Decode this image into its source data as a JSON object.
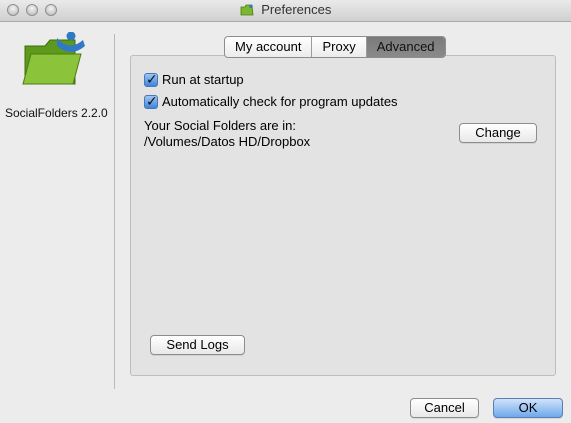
{
  "window": {
    "title": "Preferences"
  },
  "sidebar": {
    "app_name_version": "SocialFolders 2.2.0"
  },
  "tabs": [
    {
      "label": "My account",
      "active": false
    },
    {
      "label": "Proxy",
      "active": false
    },
    {
      "label": "Advanced",
      "active": true
    }
  ],
  "advanced": {
    "run_at_startup": {
      "label": "Run at startup",
      "checked": true
    },
    "auto_update": {
      "label": "Automatically check for program updates",
      "checked": true
    },
    "folders_location_label": "Your Social Folders are in:",
    "folders_location_path": "/Volumes/Datos HD/Dropbox",
    "change_button": "Change",
    "send_logs_button": "Send Logs"
  },
  "footer": {
    "cancel_button": "Cancel",
    "ok_button": "OK"
  },
  "colors": {
    "window_bg": "#ececec",
    "panel_bg": "#e3e3e3",
    "folder_green": "#7cb82f",
    "person_blue": "#2f79c6",
    "default_button": "#6fa8ea"
  }
}
